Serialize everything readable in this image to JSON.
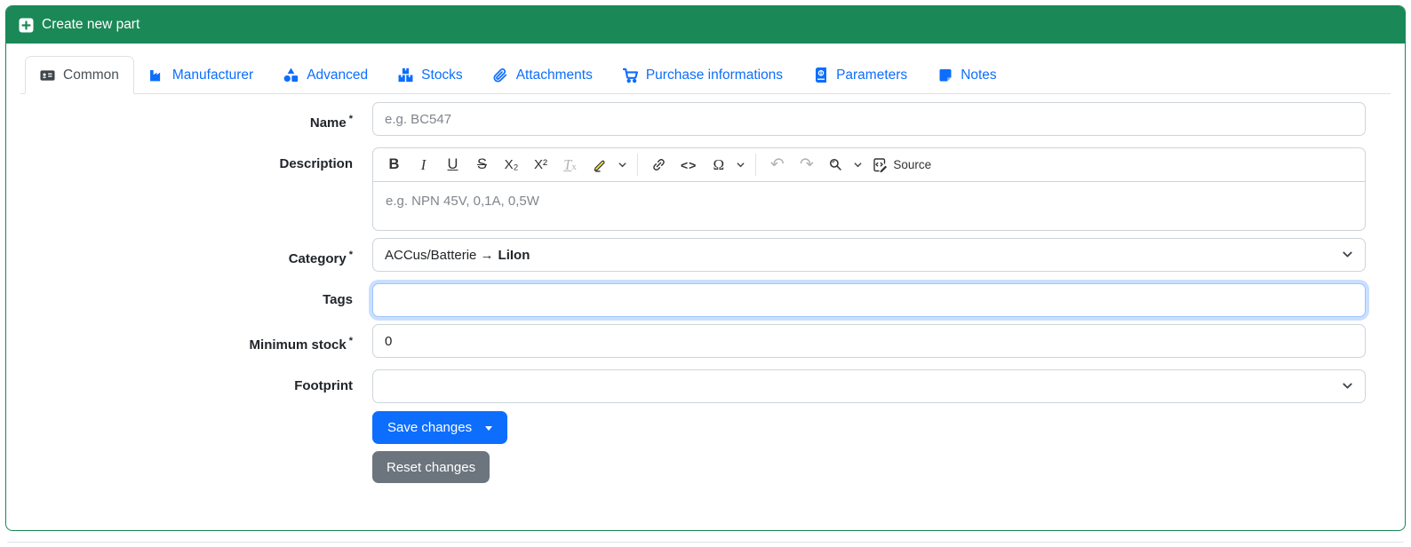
{
  "header": {
    "title": "Create new part"
  },
  "tabs": [
    {
      "label": "Common",
      "active": true
    },
    {
      "label": "Manufacturer",
      "active": false
    },
    {
      "label": "Advanced",
      "active": false
    },
    {
      "label": "Stocks",
      "active": false
    },
    {
      "label": "Attachments",
      "active": false
    },
    {
      "label": "Purchase informations",
      "active": false
    },
    {
      "label": "Parameters",
      "active": false
    },
    {
      "label": "Notes",
      "active": false
    }
  ],
  "form": {
    "required_marker": "*",
    "name_label": "Name",
    "name_placeholder": "e.g. BC547",
    "name_value": "",
    "description_label": "Description",
    "description_placeholder": "e.g. NPN 45V, 0,1A, 0,5W",
    "description_value": "",
    "category_label": "Category",
    "category_value_path": "ACCus/Batterie →",
    "category_value_leaf": "LiIon",
    "tags_label": "Tags",
    "tags_value": "",
    "min_stock_label": "Minimum stock",
    "min_stock_value": "0",
    "footprint_label": "Footprint",
    "footprint_value": "",
    "save_label": "Save changes",
    "reset_label": "Reset changes"
  },
  "editor_toolbar": {
    "bold": "B",
    "italic": "I",
    "underline": "U",
    "strikethrough": "S",
    "subscript": "X₂",
    "superscript": "X²",
    "remove_format_t": "T",
    "remove_format_x": "x",
    "code": "<>",
    "special_char": "Ω",
    "undo": "↶",
    "redo": "↷",
    "source_label": "Source"
  },
  "icons": {
    "plus-square-icon": "white square, green plus",
    "id-card-icon": "dark id card",
    "factory-icon": "blue factory",
    "shapes-icon": "triangle+circle+square",
    "boxes-icon": "stacked boxes",
    "paperclip-icon": "paperclip",
    "cart-icon": "shopping cart",
    "book-icon": "atlas book",
    "note-icon": "sticky note",
    "chevron-down-icon": "v",
    "highlight-icon": "yellow marker pen",
    "link-icon": "chain link",
    "find-replace-icon": "magnifier",
    "source-icon": "code box with pencil"
  },
  "colors": {
    "header_green": "#1b8857",
    "link_blue": "#0d6efd",
    "save_blue": "#0d6efd",
    "reset_gray": "#6c757d",
    "border_gray": "#ced4da",
    "focus_ring": "#9ec5fe"
  }
}
